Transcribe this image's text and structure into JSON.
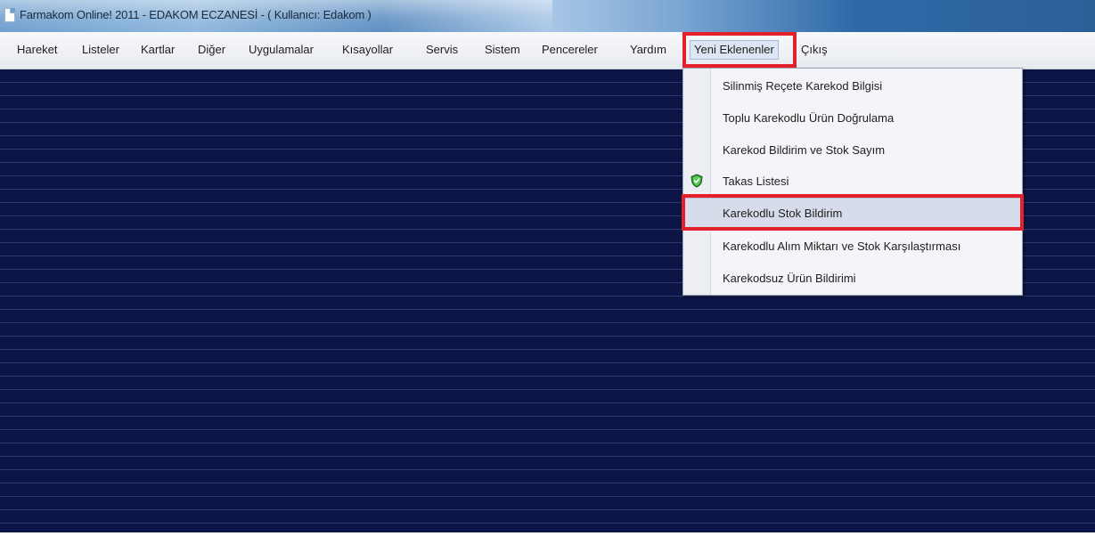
{
  "window": {
    "title": "Farmakom Online! 2011 - EDAKOM ECZANESİ - ( Kullanıcı: Edakom )"
  },
  "menubar": {
    "items": [
      {
        "label": "Hareket"
      },
      {
        "label": "Listeler"
      },
      {
        "label": "Kartlar"
      },
      {
        "label": "Diğer"
      },
      {
        "label": "Uygulamalar"
      },
      {
        "label": "Kısayollar"
      },
      {
        "label": "Servis"
      },
      {
        "label": "Sistem"
      },
      {
        "label": "Pencereler"
      },
      {
        "label": "Yardım"
      },
      {
        "label": "Yeni Eklenenler",
        "active": true
      },
      {
        "label": "Çıkış"
      }
    ]
  },
  "dropdown": {
    "items": [
      {
        "label": "Silinmiş Reçete Karekod Bilgisi"
      },
      {
        "label": "Toplu Karekodlu Ürün Doğrulama"
      },
      {
        "label": "Karekod Bildirim ve Stok Sayım"
      },
      {
        "label": "Takas Listesi",
        "icon": "green-shield-icon"
      },
      {
        "label": "Karekodlu Stok Bildirim",
        "selected": true
      },
      {
        "label": "Karekodlu Alım Miktarı ve Stok Karşılaştırması"
      },
      {
        "label": "Karekodsuz Ürün Bildirimi"
      }
    ]
  },
  "colors": {
    "workspace": "#0c1545",
    "highlight": "#e3202b",
    "titlebar": "#6f9fcf"
  }
}
